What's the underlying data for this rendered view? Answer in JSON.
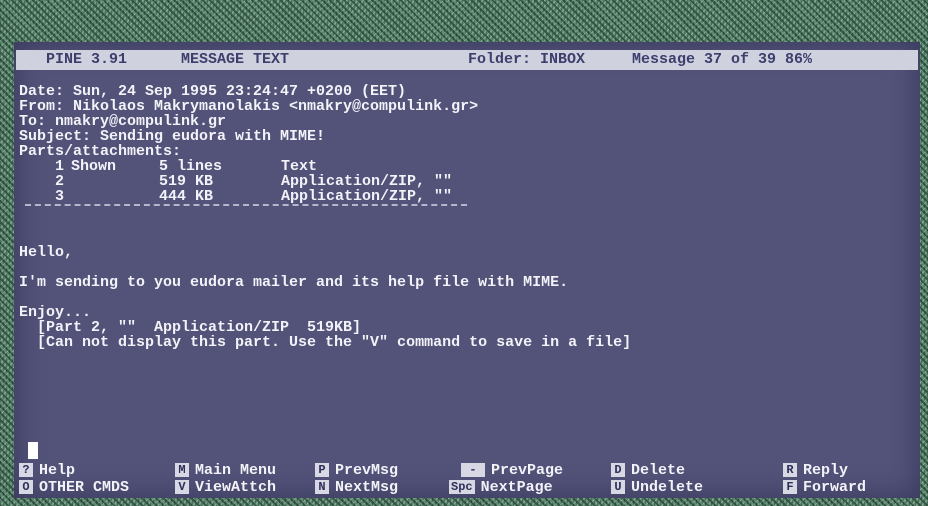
{
  "title_bar": {
    "app": "PINE 3.91",
    "mode": "MESSAGE TEXT",
    "folder": "Folder: INBOX",
    "position": "Message 37 of 39 86%"
  },
  "headers": {
    "date": "Date: Sun, 24 Sep 1995 23:24:47 +0200 (EET)",
    "from": "From: Nikolaos Makrymanolakis <nmakry@compulink.gr>",
    "to": "To: nmakry@compulink.gr",
    "subject": "Subject: Sending eudora with MIME!",
    "parts_label": "Parts/attachments:"
  },
  "attachments": [
    {
      "num": "1",
      "size": "Shown",
      "unit": "5 lines",
      "type": "Text"
    },
    {
      "num": "2",
      "size": "519",
      "unit": "KB",
      "type": "Application/ZIP, \"\""
    },
    {
      "num": "3",
      "size": "444",
      "unit": "KB",
      "type": "Application/ZIP, \"\""
    }
  ],
  "message": {
    "greeting": "Hello,",
    "line1": "I'm sending to you eudora mailer and its help file with MIME.",
    "closing": "Enjoy...",
    "part_notice": "  [Part 2, \"\"  Application/ZIP  519KB]",
    "display_notice": "  [Can not display this part. Use the \"V\" command to save in a file]"
  },
  "menu": {
    "help": {
      "key": "?",
      "label": "Help"
    },
    "other": {
      "key": "O",
      "label": "OTHER CMDS"
    },
    "main_menu": {
      "key": "M",
      "label": "Main Menu"
    },
    "view_attach": {
      "key": "V",
      "label": "ViewAttch"
    },
    "prev_msg": {
      "key": "P",
      "label": "PrevMsg"
    },
    "next_msg": {
      "key": "N",
      "label": "NextMsg"
    },
    "prev_page": {
      "key": "-",
      "label": "PrevPage"
    },
    "next_page": {
      "key": "Spc",
      "label": "NextPage"
    },
    "delete": {
      "key": "D",
      "label": "Delete"
    },
    "undelete": {
      "key": "U",
      "label": "Undelete"
    },
    "reply": {
      "key": "R",
      "label": "Reply"
    },
    "forward": {
      "key": "F",
      "label": "Forward"
    }
  },
  "colors": {
    "screen_bg": "#53537a",
    "title_bar_bg": "#cfd1de",
    "text": "#f2f2f8",
    "desktop_pattern": "#5d8a72"
  }
}
